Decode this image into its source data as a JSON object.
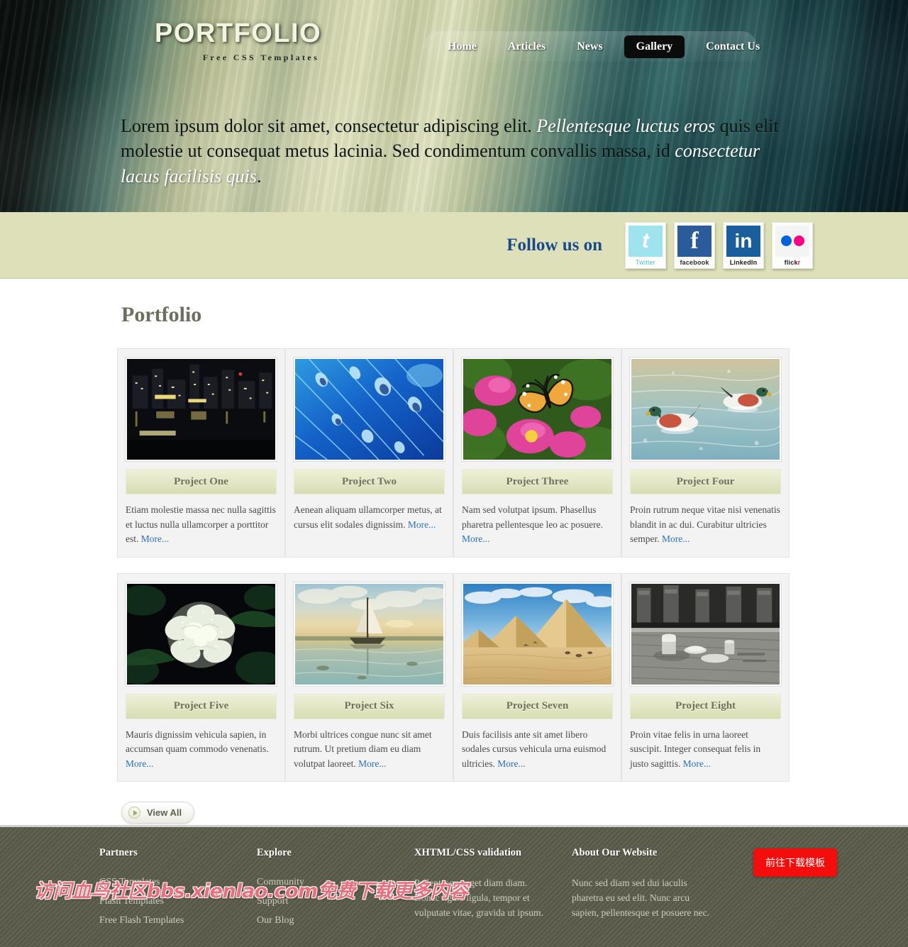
{
  "header": {
    "brand_title": "PORTFOLIO",
    "brand_subtitle": "Free CSS Templates",
    "nav": [
      {
        "label": "Home",
        "active": false
      },
      {
        "label": "Articles",
        "active": false
      },
      {
        "label": "News",
        "active": false
      },
      {
        "label": "Gallery",
        "active": true
      },
      {
        "label": "Contact Us",
        "active": false
      }
    ],
    "hero": {
      "part1": "Lorem ipsum dolor sit amet, consectetur adipiscing elit. ",
      "em1": "Pellentesque luctus eros",
      "part2": " quis elit molestie ut consequat metus lacinia. Sed condimentum convallis massa, id ",
      "em2": "consectetur lacus facilisis quis",
      "part3": "."
    }
  },
  "social": {
    "label": "Follow us on",
    "items": [
      {
        "icon": "twitter-icon",
        "caption": "Twitter",
        "glyph": "t"
      },
      {
        "icon": "facebook-icon",
        "caption": "facebook",
        "glyph": "f"
      },
      {
        "icon": "linkedin-icon",
        "caption": "LinkedIn",
        "glyph": "in"
      },
      {
        "icon": "flickr-icon",
        "caption": "flick",
        "caption_accent": "r"
      }
    ]
  },
  "main": {
    "page_title": "Portfolio",
    "view_all_label": "View All",
    "projects": [
      {
        "title": "Project One",
        "text": "Etiam molestie massa nec nulla sagittis et luctus nulla ullamcorper a porttitor est. ",
        "more": "More...",
        "image": "city-night-skyline"
      },
      {
        "title": "Project Two",
        "text": "Aenean aliquam ullamcorper metus, at cursus elit sodales dignissim. ",
        "more": "More...",
        "image": "blue-water-droplets"
      },
      {
        "title": "Project Three",
        "text": "Nam sed volutpat ipsum. Phasellus pharetra pellentesque leo ac posuere. ",
        "more": "More...",
        "image": "butterfly-on-pink-flower"
      },
      {
        "title": "Project Four",
        "text": "Proin rutrum neque vitae nisi venenatis blandit in ac dui. Curabitur ultricies semper. ",
        "more": "More...",
        "image": "ducks-on-water"
      },
      {
        "title": "Project Five",
        "text": "Mauris dignissim vehicula sapien, in accumsan quam commodo venenatis. ",
        "more": "More...",
        "image": "white-rose-dark"
      },
      {
        "title": "Project Six",
        "text": "Morbi ultrices congue nunc sit amet rutrum. Ut pretium diam eu diam volutpat laoreet. ",
        "more": "More...",
        "image": "sailboat-sunset-lagoon"
      },
      {
        "title": "Project Seven",
        "text": "Duis facilisis ante sit amet libero sodales cursus vehicula urna euismod ultricies. ",
        "more": "More...",
        "image": "pyramids-desert"
      },
      {
        "title": "Project Eight",
        "text": "Proin vitae felis in urna laoreet suscipit. Integer consequat felis in justo sagittis. ",
        "more": "More...",
        "image": "cafe-table-bw"
      }
    ]
  },
  "footer": {
    "columns": [
      {
        "heading": "Partners",
        "links": [
          "CSS Templates",
          "Flash Templates",
          "Free Flash Templates"
        ]
      },
      {
        "heading": "Explore",
        "links": [
          "Community",
          "Support",
          "Our Blog"
        ]
      },
      {
        "heading": "XHTML/CSS validation",
        "text": "Pellentesque eget diam diam. Donec ligula ligula, tempor et vulputate vitae, gravida ut ipsum."
      },
      {
        "heading": "About Our Website",
        "text": "Nunc sed diam sed dui iaculis pharetra eu sed elit. Nunc arcu sapien, pellentesque et posuere nec."
      }
    ],
    "download_button": "前往下载模板",
    "watermark": "访问血鸟社区bbs.xienlao.com免费下载更多内容"
  },
  "colors": {
    "accent_blue": "#1a4a86",
    "link_blue": "#2c6fb8",
    "olive_bar": "#dde0b8",
    "title_gray": "#6e6e5e",
    "download_red": "#f40d0d",
    "watermark_pink": "#e8707e"
  }
}
